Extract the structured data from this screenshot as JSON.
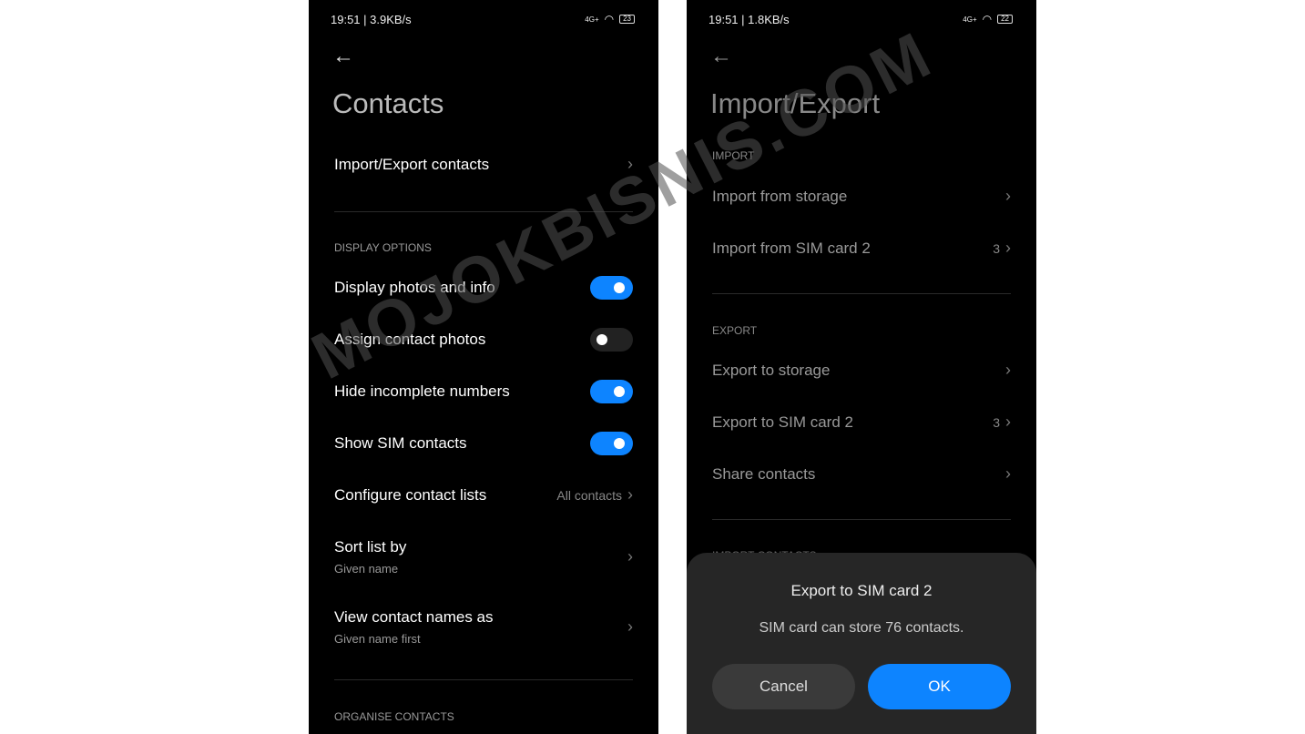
{
  "watermark": "MOJOKBISNIS.COM",
  "left": {
    "status": {
      "time": "19:51 | 3.9KB/s",
      "network": "4G+",
      "battery": "23"
    },
    "title": "Contacts",
    "import_export": "Import/Export contacts",
    "display_section": "DISPLAY OPTIONS",
    "toggles": [
      {
        "label": "Display photos and info",
        "on": true
      },
      {
        "label": "Assign contact photos",
        "on": false
      },
      {
        "label": "Hide incomplete numbers",
        "on": true
      },
      {
        "label": "Show SIM contacts",
        "on": true
      }
    ],
    "configure": {
      "label": "Configure contact lists",
      "value": "All contacts"
    },
    "sort": {
      "label": "Sort list by",
      "sub": "Given name"
    },
    "view_names": {
      "label": "View contact names as",
      "sub": "Given name first"
    },
    "organise_section": "ORGANISE CONTACTS"
  },
  "right": {
    "status": {
      "time": "19:51 | 1.8KB/s",
      "network": "4G+",
      "battery": "22"
    },
    "title": "Import/Export",
    "import_section": "IMPORT",
    "import_storage": "Import from storage",
    "import_sim": {
      "label": "Import from SIM card 2",
      "count": "3"
    },
    "export_section": "EXPORT",
    "export_storage": "Export to storage",
    "export_sim": {
      "label": "Export to SIM card 2",
      "count": "3"
    },
    "share": "Share contacts",
    "import_contacts_section": "IMPORT CONTACTS",
    "dialog": {
      "title": "Export to SIM card 2",
      "message": "SIM card can store 76 contacts.",
      "cancel": "Cancel",
      "ok": "OK"
    }
  },
  "colors": {
    "accent": "#0d84ff"
  }
}
